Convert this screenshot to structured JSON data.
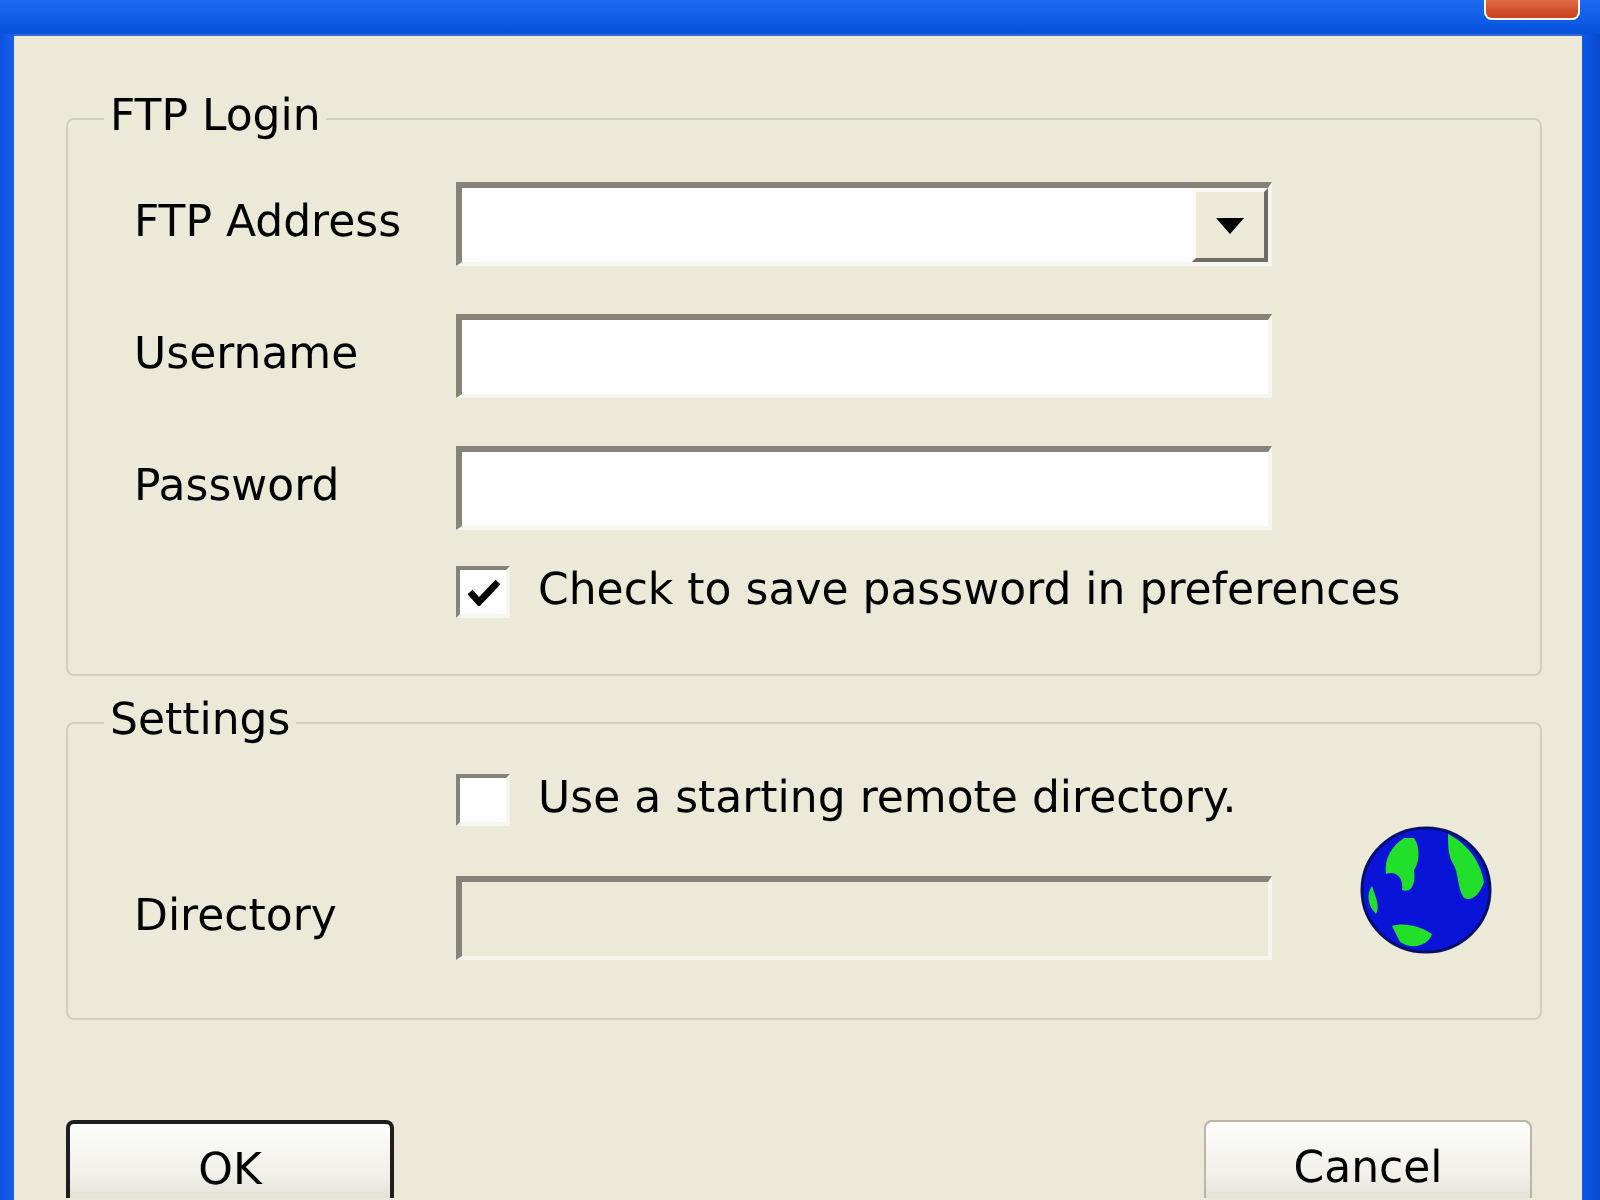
{
  "groups": [
    {
      "title": "FTP Login",
      "rows": [
        {
          "kind": "combo",
          "label": "FTP Address",
          "disabled": false
        },
        {
          "kind": "text",
          "label": "Username",
          "disabled": false
        },
        {
          "kind": "password",
          "label": "Password",
          "disabled": false
        },
        {
          "kind": "checkbox",
          "label": "Check to save password in preferences",
          "checked": true,
          "disabled": false
        }
      ]
    },
    {
      "title": "Settings",
      "rows": [
        {
          "kind": "checkbox",
          "label": "Use a starting remote directory.",
          "checked": false,
          "disabled": false
        },
        {
          "kind": "text",
          "label": "Directory",
          "disabled": true
        }
      ]
    }
  ],
  "buttons": [
    {
      "label": "OK",
      "default": true
    },
    {
      "label": "Cancel",
      "default": false
    }
  ]
}
